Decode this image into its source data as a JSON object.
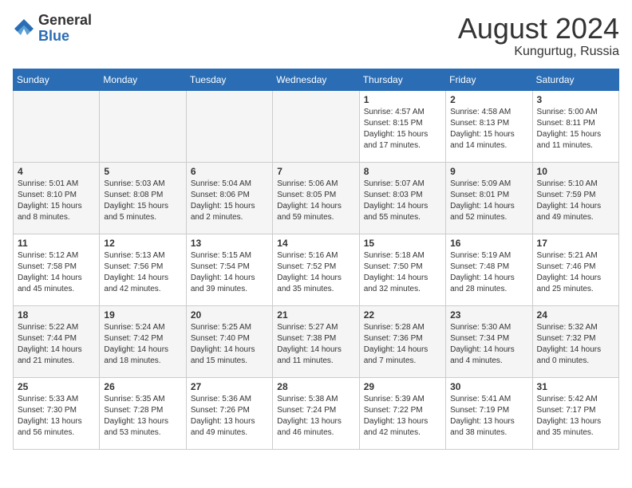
{
  "header": {
    "logo_general": "General",
    "logo_blue": "Blue",
    "month_year": "August 2024",
    "location": "Kungurtug, Russia"
  },
  "weekdays": [
    "Sunday",
    "Monday",
    "Tuesday",
    "Wednesday",
    "Thursday",
    "Friday",
    "Saturday"
  ],
  "weeks": [
    [
      {
        "day": "",
        "empty": true
      },
      {
        "day": "",
        "empty": true
      },
      {
        "day": "",
        "empty": true
      },
      {
        "day": "",
        "empty": true
      },
      {
        "day": "1",
        "sunrise": "4:57 AM",
        "sunset": "8:15 PM",
        "daylight": "15 hours and 17 minutes."
      },
      {
        "day": "2",
        "sunrise": "4:58 AM",
        "sunset": "8:13 PM",
        "daylight": "15 hours and 14 minutes."
      },
      {
        "day": "3",
        "sunrise": "5:00 AM",
        "sunset": "8:11 PM",
        "daylight": "15 hours and 11 minutes."
      }
    ],
    [
      {
        "day": "4",
        "sunrise": "5:01 AM",
        "sunset": "8:10 PM",
        "daylight": "15 hours and 8 minutes."
      },
      {
        "day": "5",
        "sunrise": "5:03 AM",
        "sunset": "8:08 PM",
        "daylight": "15 hours and 5 minutes."
      },
      {
        "day": "6",
        "sunrise": "5:04 AM",
        "sunset": "8:06 PM",
        "daylight": "15 hours and 2 minutes."
      },
      {
        "day": "7",
        "sunrise": "5:06 AM",
        "sunset": "8:05 PM",
        "daylight": "14 hours and 59 minutes."
      },
      {
        "day": "8",
        "sunrise": "5:07 AM",
        "sunset": "8:03 PM",
        "daylight": "14 hours and 55 minutes."
      },
      {
        "day": "9",
        "sunrise": "5:09 AM",
        "sunset": "8:01 PM",
        "daylight": "14 hours and 52 minutes."
      },
      {
        "day": "10",
        "sunrise": "5:10 AM",
        "sunset": "7:59 PM",
        "daylight": "14 hours and 49 minutes."
      }
    ],
    [
      {
        "day": "11",
        "sunrise": "5:12 AM",
        "sunset": "7:58 PM",
        "daylight": "14 hours and 45 minutes."
      },
      {
        "day": "12",
        "sunrise": "5:13 AM",
        "sunset": "7:56 PM",
        "daylight": "14 hours and 42 minutes."
      },
      {
        "day": "13",
        "sunrise": "5:15 AM",
        "sunset": "7:54 PM",
        "daylight": "14 hours and 39 minutes."
      },
      {
        "day": "14",
        "sunrise": "5:16 AM",
        "sunset": "7:52 PM",
        "daylight": "14 hours and 35 minutes."
      },
      {
        "day": "15",
        "sunrise": "5:18 AM",
        "sunset": "7:50 PM",
        "daylight": "14 hours and 32 minutes."
      },
      {
        "day": "16",
        "sunrise": "5:19 AM",
        "sunset": "7:48 PM",
        "daylight": "14 hours and 28 minutes."
      },
      {
        "day": "17",
        "sunrise": "5:21 AM",
        "sunset": "7:46 PM",
        "daylight": "14 hours and 25 minutes."
      }
    ],
    [
      {
        "day": "18",
        "sunrise": "5:22 AM",
        "sunset": "7:44 PM",
        "daylight": "14 hours and 21 minutes."
      },
      {
        "day": "19",
        "sunrise": "5:24 AM",
        "sunset": "7:42 PM",
        "daylight": "14 hours and 18 minutes."
      },
      {
        "day": "20",
        "sunrise": "5:25 AM",
        "sunset": "7:40 PM",
        "daylight": "14 hours and 15 minutes."
      },
      {
        "day": "21",
        "sunrise": "5:27 AM",
        "sunset": "7:38 PM",
        "daylight": "14 hours and 11 minutes."
      },
      {
        "day": "22",
        "sunrise": "5:28 AM",
        "sunset": "7:36 PM",
        "daylight": "14 hours and 7 minutes."
      },
      {
        "day": "23",
        "sunrise": "5:30 AM",
        "sunset": "7:34 PM",
        "daylight": "14 hours and 4 minutes."
      },
      {
        "day": "24",
        "sunrise": "5:32 AM",
        "sunset": "7:32 PM",
        "daylight": "14 hours and 0 minutes."
      }
    ],
    [
      {
        "day": "25",
        "sunrise": "5:33 AM",
        "sunset": "7:30 PM",
        "daylight": "13 hours and 56 minutes."
      },
      {
        "day": "26",
        "sunrise": "5:35 AM",
        "sunset": "7:28 PM",
        "daylight": "13 hours and 53 minutes."
      },
      {
        "day": "27",
        "sunrise": "5:36 AM",
        "sunset": "7:26 PM",
        "daylight": "13 hours and 49 minutes."
      },
      {
        "day": "28",
        "sunrise": "5:38 AM",
        "sunset": "7:24 PM",
        "daylight": "13 hours and 46 minutes."
      },
      {
        "day": "29",
        "sunrise": "5:39 AM",
        "sunset": "7:22 PM",
        "daylight": "13 hours and 42 minutes."
      },
      {
        "day": "30",
        "sunrise": "5:41 AM",
        "sunset": "7:19 PM",
        "daylight": "13 hours and 38 minutes."
      },
      {
        "day": "31",
        "sunrise": "5:42 AM",
        "sunset": "7:17 PM",
        "daylight": "13 hours and 35 minutes."
      }
    ]
  ]
}
